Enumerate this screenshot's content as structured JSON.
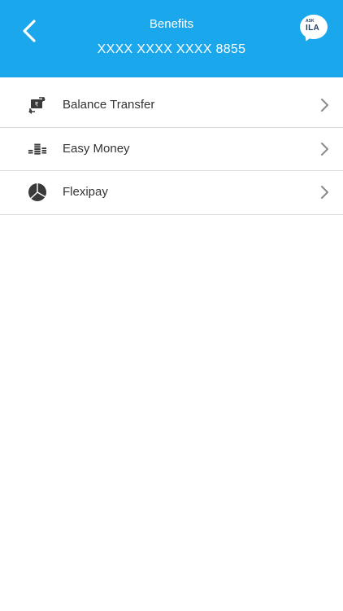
{
  "header": {
    "title": "Benefits",
    "card_number": "XXXX XXXX XXXX 8855",
    "back_icon": "chevron-left-icon",
    "assistant": {
      "small_text": "ASK",
      "big_text": "ILA"
    },
    "background_color": "#1aa7ec"
  },
  "benefits": [
    {
      "label": "Balance Transfer",
      "icon": "balance-transfer-icon"
    },
    {
      "label": "Easy Money",
      "icon": "coin-stack-icon"
    },
    {
      "label": "Flexipay",
      "icon": "pie-chart-icon"
    }
  ]
}
